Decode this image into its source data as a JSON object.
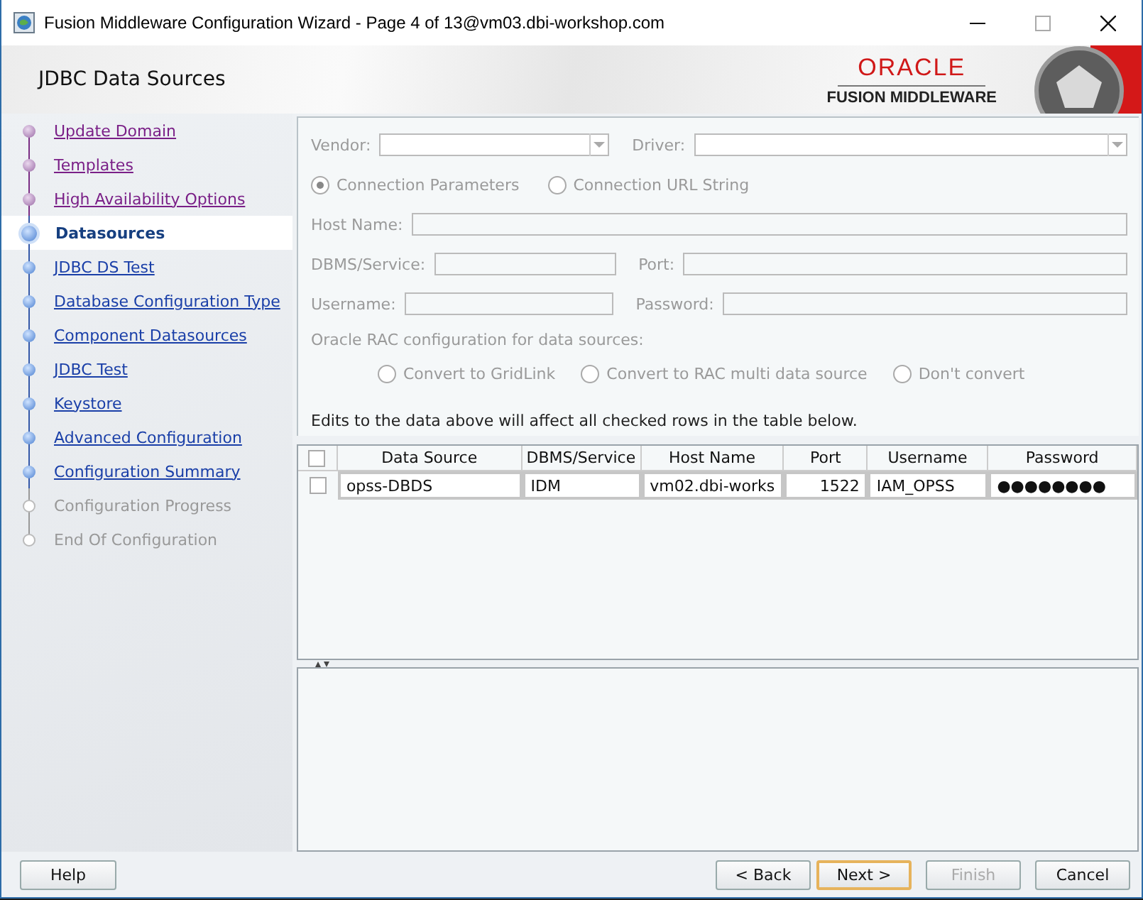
{
  "window": {
    "title": "Fusion Middleware Configuration Wizard - Page 4 of 13@vm03.dbi-workshop.com"
  },
  "header": {
    "title": "JDBC Data Sources",
    "logo_name": "ORACLE",
    "logo_subtitle": "FUSION MIDDLEWARE"
  },
  "steps": [
    {
      "label": "Update Domain",
      "kind": "visited",
      "selected": false
    },
    {
      "label": "Templates",
      "kind": "visited",
      "selected": false
    },
    {
      "label": "High Availability Options",
      "kind": "visited",
      "selected": false
    },
    {
      "label": "Datasources",
      "kind": "link",
      "selected": true
    },
    {
      "label": "JDBC DS Test",
      "kind": "link",
      "selected": false
    },
    {
      "label": "Database Configuration Type",
      "kind": "link",
      "selected": false
    },
    {
      "label": "Component Datasources",
      "kind": "link",
      "selected": false
    },
    {
      "label": "JDBC Test",
      "kind": "link",
      "selected": false
    },
    {
      "label": "Keystore",
      "kind": "link",
      "selected": false
    },
    {
      "label": "Advanced Configuration",
      "kind": "link",
      "selected": false
    },
    {
      "label": "Configuration Summary",
      "kind": "link",
      "selected": false
    },
    {
      "label": "Configuration Progress",
      "kind": "disabled",
      "selected": false
    },
    {
      "label": "End Of Configuration",
      "kind": "disabled",
      "selected": false
    }
  ],
  "form": {
    "disabled": true,
    "vendor_label": "Vendor:",
    "driver_label": "Driver:",
    "connection_modes": [
      {
        "label": "Connection Parameters",
        "selected": true
      },
      {
        "label": "Connection URL String",
        "selected": false
      }
    ],
    "host_label": "Host Name:",
    "dbms_label": "DBMS/Service:",
    "port_label": "Port:",
    "username_label": "Username:",
    "password_label": "Password:",
    "rac_label": "Oracle RAC configuration for data sources:",
    "rac_options": [
      {
        "label": "Convert to GridLink",
        "selected": false
      },
      {
        "label": "Convert to RAC multi data source",
        "selected": false
      },
      {
        "label": "Don't convert",
        "selected": false
      }
    ],
    "note": "Edits to the data above will affect all checked rows in the table below."
  },
  "table": {
    "header_checked": false,
    "columns": [
      "Data Source",
      "DBMS/Service",
      "Host Name",
      "Port",
      "Username",
      "Password"
    ],
    "rows": [
      {
        "checked": false,
        "cells": [
          "opss-DBDS",
          "IDM",
          "vm02.dbi-works",
          "1522",
          "IAM_OPSS",
          "●●●●●●●●"
        ]
      }
    ]
  },
  "buttons": [
    {
      "label": "Help",
      "disabled": false,
      "focused": false
    },
    {
      "label": "< Back",
      "disabled": false,
      "focused": false
    },
    {
      "label": "Next >",
      "disabled": false,
      "focused": true
    },
    {
      "label": "Finish",
      "disabled": true,
      "focused": false
    },
    {
      "label": "Cancel",
      "disabled": false,
      "focused": false
    }
  ]
}
